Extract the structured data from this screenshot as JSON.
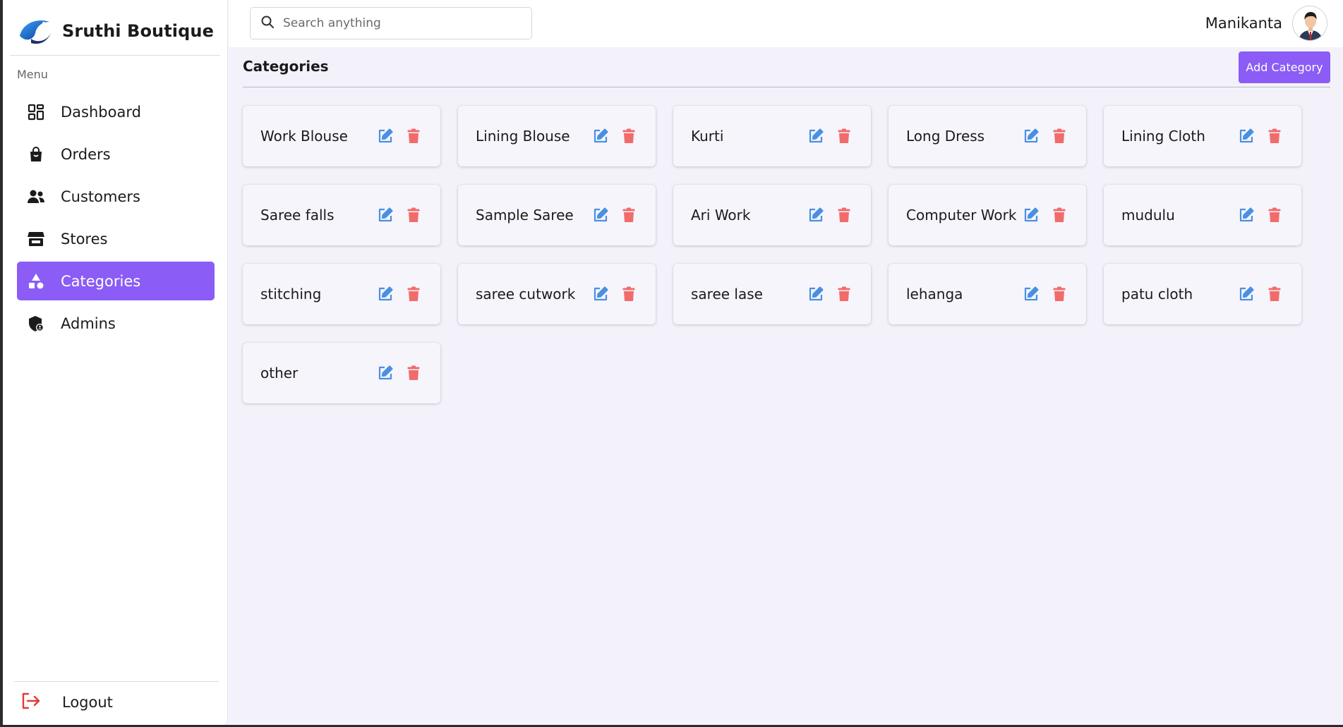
{
  "brand": {
    "name": "Sruthi Boutique"
  },
  "sidebar": {
    "menu_heading": "Menu",
    "items": [
      {
        "label": "Dashboard",
        "icon": "dashboard-icon",
        "active": false
      },
      {
        "label": "Orders",
        "icon": "shopping-bag-icon",
        "active": false
      },
      {
        "label": "Customers",
        "icon": "users-icon",
        "active": false
      },
      {
        "label": "Stores",
        "icon": "store-icon",
        "active": false
      },
      {
        "label": "Categories",
        "icon": "shapes-icon",
        "active": true
      },
      {
        "label": "Admins",
        "icon": "admin-shield-icon",
        "active": false
      }
    ],
    "logout_label": "Logout"
  },
  "search": {
    "placeholder": "Search anything",
    "value": ""
  },
  "user": {
    "name": "Manikanta"
  },
  "main": {
    "title": "Categories",
    "add_button_label": "Add Category",
    "categories": [
      "Work Blouse",
      "Lining Blouse",
      "Kurti",
      "Long Dress",
      "Lining Cloth",
      "Saree falls",
      "Sample Saree",
      "Ari Work",
      "Computer Work",
      "mudulu",
      "stitching",
      "saree cutwork",
      "saree lase",
      "lehanga",
      "patu cloth",
      "other"
    ]
  },
  "colors": {
    "accent": "#8b5cf6",
    "edit_icon": "#4a90e2",
    "delete_icon": "#f26b6b",
    "logout_icon": "#e53935",
    "background": "#f3f2fb"
  }
}
